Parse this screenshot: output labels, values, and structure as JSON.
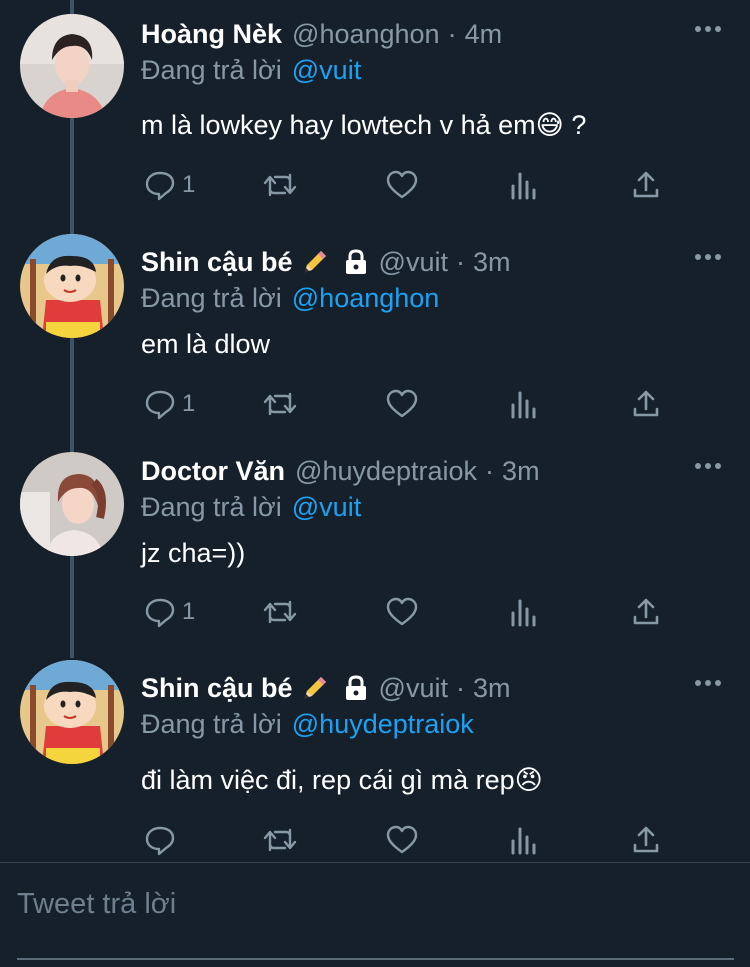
{
  "tweets": [
    {
      "name": "Hoàng Nèk",
      "handle": "@hoanghon",
      "separator": "·",
      "time": "4m",
      "replying_prefix": "Đang trả lời",
      "replying_to": "@vuit",
      "text": "m là lowkey hay lowtech v hả em😅 ?",
      "reply_count": "1",
      "avatar_icon": "person-photo-avatar"
    },
    {
      "name": "Shin cậu bé",
      "name_emoji": "pencil-icon",
      "protected": true,
      "handle": "@vuit",
      "separator": "·",
      "time": "3m",
      "replying_prefix": "Đang trả lời",
      "replying_to": "@hoanghon",
      "text": "em là dlow",
      "reply_count": "1",
      "avatar_icon": "shin-chan-avatar"
    },
    {
      "name": "Doctor Văn",
      "handle": "@huydeptraiok",
      "separator": "·",
      "time": "3m",
      "replying_prefix": "Đang trả lời",
      "replying_to": "@vuit",
      "text": "jz cha=))",
      "reply_count": "1",
      "avatar_icon": "person-photo-avatar"
    },
    {
      "name": "Shin cậu bé",
      "name_emoji": "pencil-icon",
      "protected": true,
      "handle": "@vuit",
      "separator": "·",
      "time": "3m",
      "replying_prefix": "Đang trả lời",
      "replying_to": "@huydeptraiok",
      "text": "đi làm việc đi, rep cái gì mà rep😠",
      "reply_count": "",
      "avatar_icon": "shin-chan-avatar"
    }
  ],
  "reply_box": {
    "placeholder": "Tweet trả lời"
  },
  "colors": {
    "background": "#15202b",
    "accent": "#1da1f2",
    "secondary_text": "#8899a6",
    "thread_line": "#3d5466"
  }
}
